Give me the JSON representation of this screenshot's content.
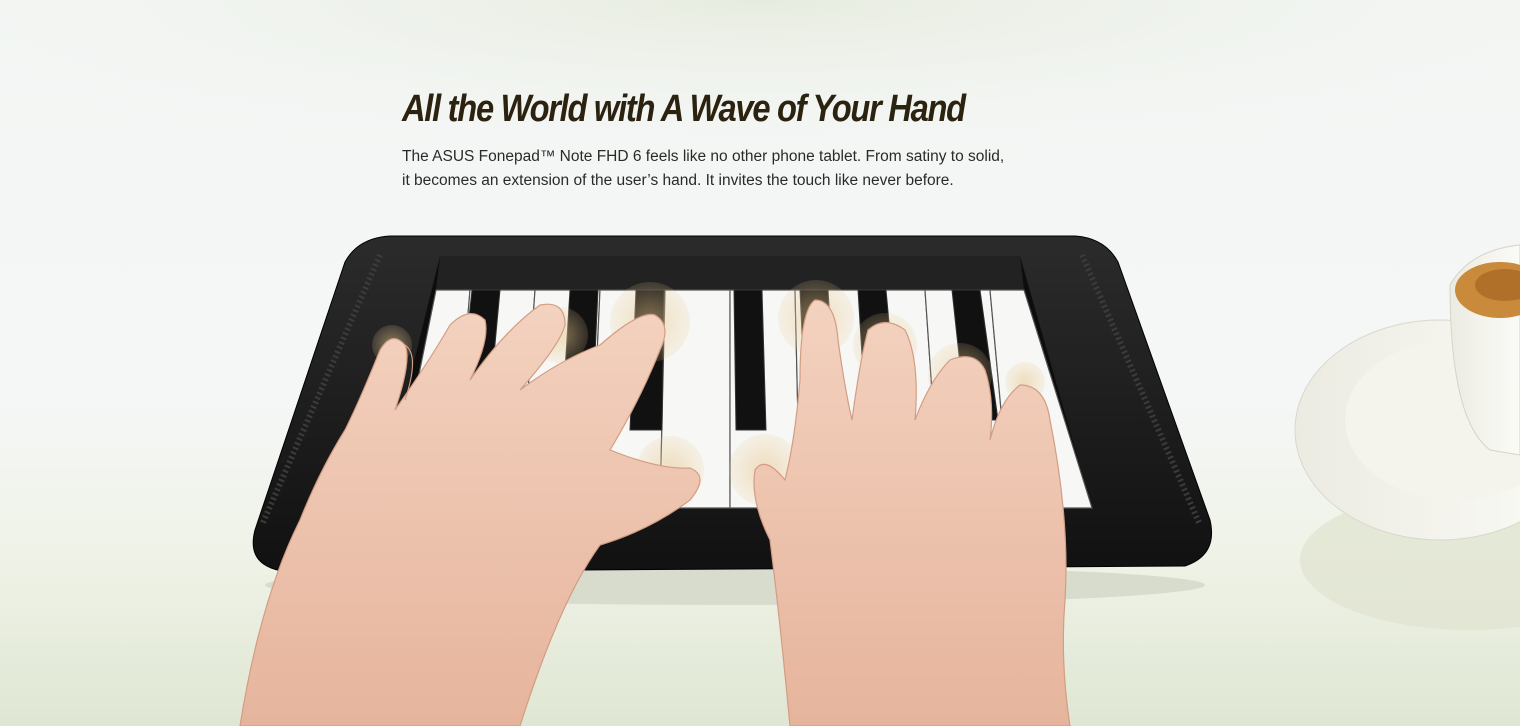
{
  "headline": "All the World with A Wave of Your Hand",
  "body_lines": [
    "The ASUS Fonepad™ Note FHD 6 feels like no other phone tablet. From satiny to solid,",
    "it becomes an extension of the user’s hand. It invites the touch like never before."
  ],
  "colors": {
    "headline": "#2c2210",
    "body": "#2a2a2a",
    "tablet_bezel": "#1b1b1b",
    "touch_ripple": "#e8c890"
  },
  "icons": [
    "tablet-image",
    "piano-keys-image",
    "left-hand-image",
    "right-hand-image",
    "teacup-image"
  ]
}
